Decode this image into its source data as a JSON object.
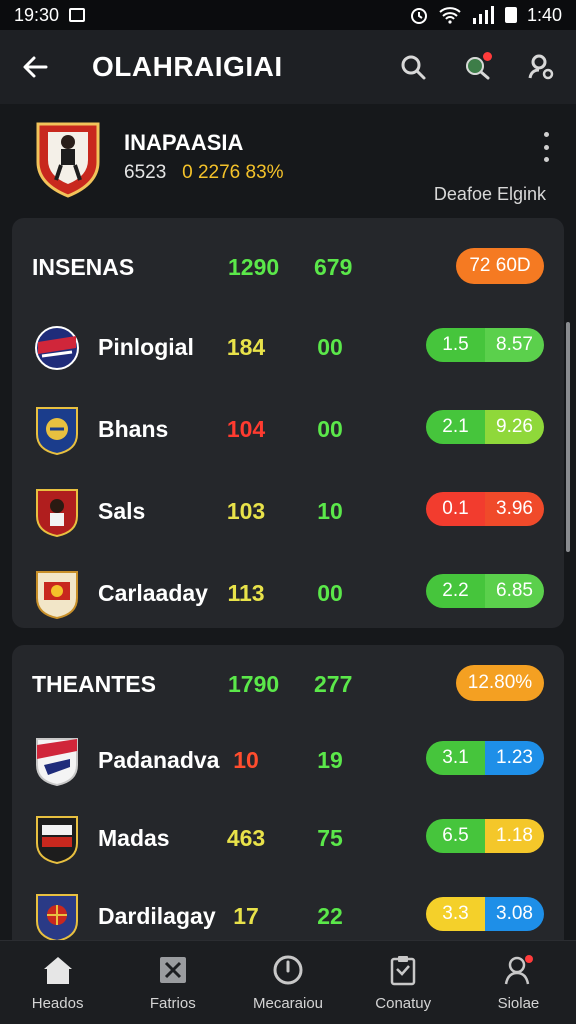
{
  "status_bar": {
    "time": "19:30",
    "right_time": "1:40"
  },
  "app_bar": {
    "title": "OLAHRAIGIAI"
  },
  "team": {
    "name": "INAPAASIA",
    "stat_a": "6523",
    "stat_b": "0 2276 83%",
    "link": "Deafoe Elgink"
  },
  "groups": [
    {
      "title": "INSENAS",
      "v1": "1290",
      "v2": "679",
      "badge": "72 60D",
      "badge_color": "#f57a22",
      "rows": [
        {
          "name": "Pinlogial",
          "v1": "184",
          "v1_color": "#e8e24a",
          "v2": "00",
          "odds_a": "1.5",
          "odds_b": "8.57",
          "color_a": "#46c53c",
          "color_b": "#5bd04c"
        },
        {
          "name": "Bhans",
          "v1": "104",
          "v1_color": "#ff3b30",
          "v2": "00",
          "odds_a": "2.1",
          "odds_b": "9.26",
          "color_a": "#46c53c",
          "color_b": "#8fd83a"
        },
        {
          "name": "Sals",
          "v1": "103",
          "v1_color": "#e8e24a",
          "v2": "10",
          "odds_a": "0.1",
          "odds_b": "3.96",
          "color_a": "#f23c2e",
          "color_b": "#f04a2a"
        },
        {
          "name": "Carlaaday",
          "v1": "113",
          "v1_color": "#e8e24a",
          "v2": "00",
          "odds_a": "2.2",
          "odds_b": "6.85",
          "color_a": "#46c53c",
          "color_b": "#5bd04c"
        }
      ]
    },
    {
      "title": "THEANTES",
      "v1": "1790",
      "v2": "277",
      "badge": "12.80%",
      "badge_color": "#f4a022",
      "rows": [
        {
          "name": "Padanadva",
          "v1": "10",
          "v1_color": "#ff4d2e",
          "v2": "19",
          "odds_a": "3.1",
          "odds_b": "1.23",
          "color_a": "#46c53c",
          "color_b": "#1e8fe8"
        },
        {
          "name": "Madas",
          "v1": "463",
          "v1_color": "#e8e24a",
          "v2": "75",
          "odds_a": "6.5",
          "odds_b": "1.18",
          "color_a": "#46c53c",
          "color_b": "#f4c72a"
        },
        {
          "name": "Dardilagay",
          "v1": "17",
          "v1_color": "#e8e24a",
          "v2": "22",
          "odds_a": "3.3",
          "odds_b": "3.08",
          "color_a": "#f4d02a",
          "color_b": "#1e8fe8"
        }
      ]
    }
  ],
  "nav": [
    {
      "label": "Heados",
      "icon": "home-icon"
    },
    {
      "label": "Fatrios",
      "icon": "pitch-icon"
    },
    {
      "label": "Mecaraiou",
      "icon": "clock-icon"
    },
    {
      "label": "Conatuy",
      "icon": "clipboard-icon"
    },
    {
      "label": "Siolae",
      "icon": "profile-icon"
    }
  ]
}
